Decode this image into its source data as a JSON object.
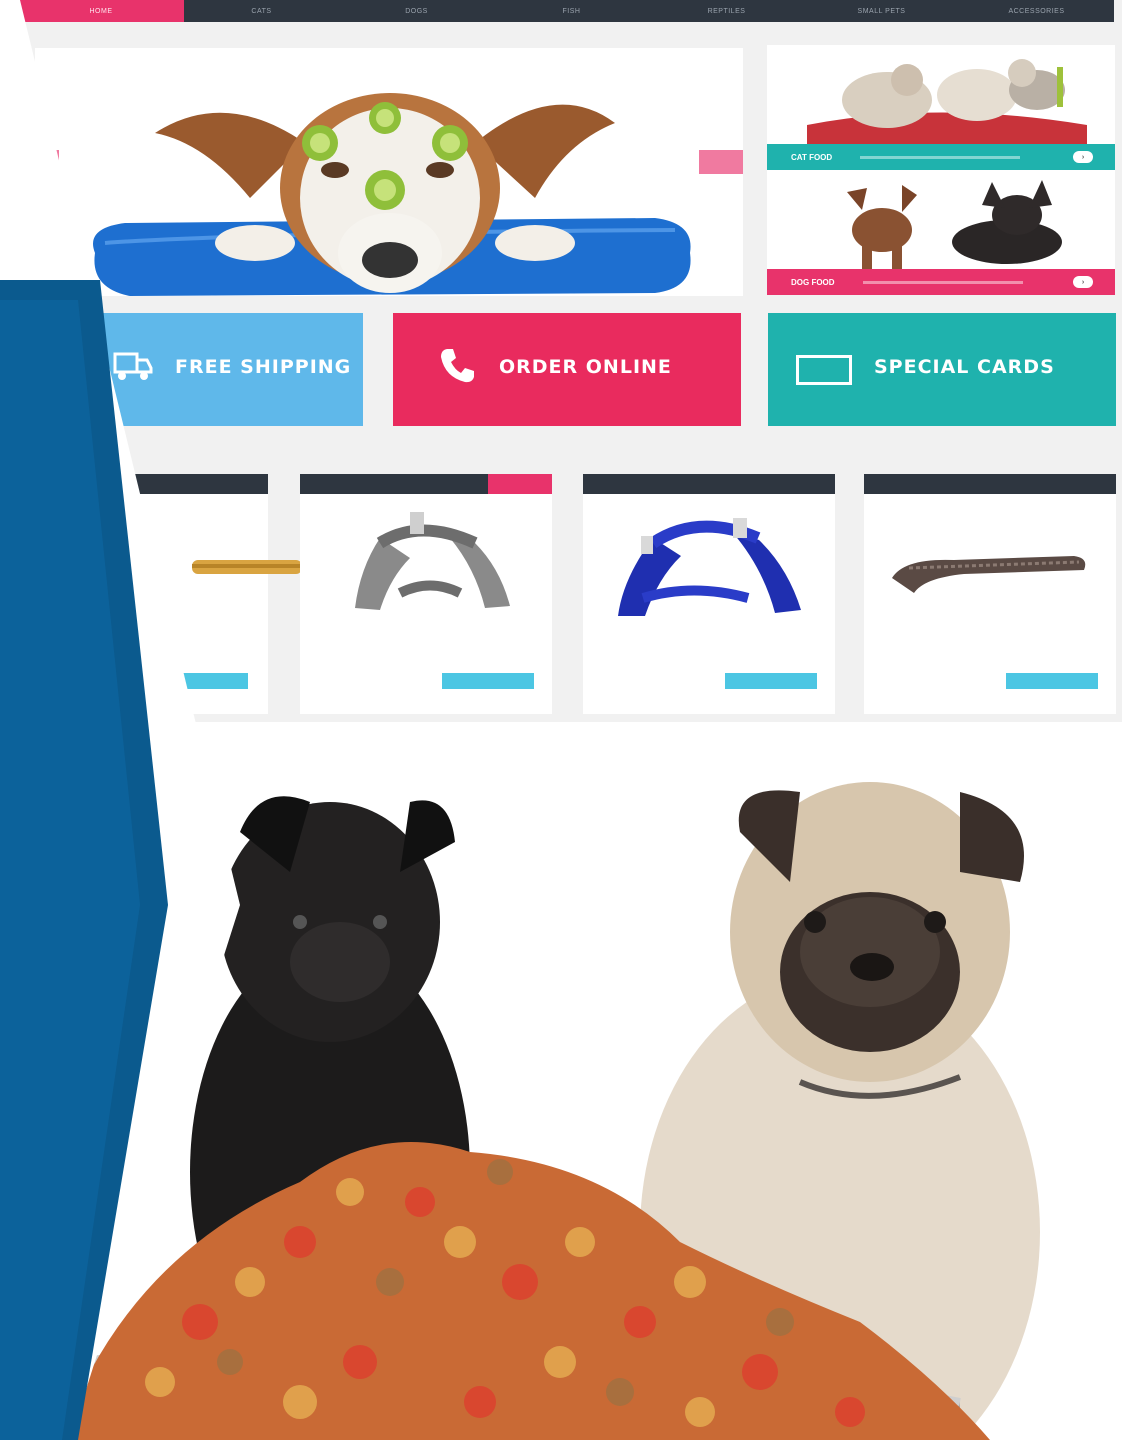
{
  "navigation": {
    "items": [
      {
        "label": "Home",
        "active": true
      },
      {
        "label": "Cats",
        "active": false
      },
      {
        "label": "Dogs",
        "active": false
      },
      {
        "label": "Fish",
        "active": false
      },
      {
        "label": "Reptiles",
        "active": false
      },
      {
        "label": "Small Pets",
        "active": false
      },
      {
        "label": "Accessories",
        "active": false
      }
    ]
  },
  "side_banners": [
    {
      "label": "Cat Food",
      "color": "#1fb2ad"
    },
    {
      "label": "Dog Food",
      "color": "#e8336b"
    }
  ],
  "promos": {
    "shipping": {
      "title": "FREE SHIPPING",
      "subtitle": ""
    },
    "order": {
      "title": "ORDER ONLINE",
      "subtitle": ""
    },
    "cards": {
      "title": "SPECIAL CARDS",
      "subtitle": ""
    }
  },
  "products": {
    "sale_tag": "",
    "items": [
      {
        "name": "",
        "description": "",
        "price": "",
        "old_price": "",
        "button": ""
      },
      {
        "name": "",
        "description": "",
        "price": "",
        "old_price": "",
        "button": ""
      },
      {
        "name": "",
        "description": "",
        "price": "",
        "old_price": "",
        "button": ""
      },
      {
        "name": "",
        "description": "",
        "price": "",
        "old_price": "",
        "button": ""
      }
    ]
  },
  "icons": {
    "order": "phone-icon",
    "shipping": "truck-icon",
    "cards": "card-icon"
  },
  "colors": {
    "nav_bg": "#2e3640",
    "accent_pink": "#e8336b",
    "teal": "#1fb2ad",
    "sky_blue": "#5fb8ea",
    "chevron_blue": "#0b5a8e"
  }
}
